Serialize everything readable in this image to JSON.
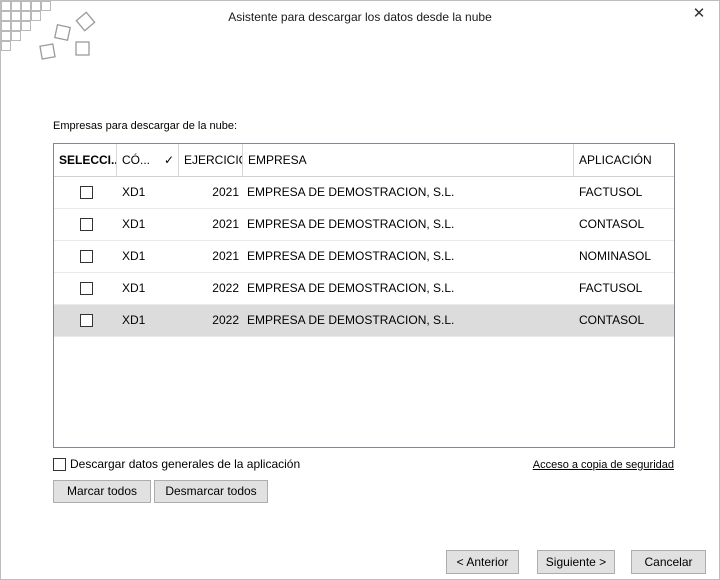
{
  "window": {
    "title": "Asistente para descargar los datos desde la nube",
    "close_glyph": "✕"
  },
  "section_label": "Empresas para descargar de la nube:",
  "grid": {
    "headers": {
      "select": "SELECCI...",
      "code": "CÓ...",
      "code_check": "✓",
      "year": "EJERCICIO",
      "company": "EMPRESA",
      "application": "APLICACIÓN"
    },
    "rows": [
      {
        "selected": false,
        "code": "XD1",
        "year": "2021",
        "company": "EMPRESA DE DEMOSTRACION, S.L.",
        "application": "FACTUSOL"
      },
      {
        "selected": false,
        "code": "XD1",
        "year": "2021",
        "company": "EMPRESA DE DEMOSTRACION, S.L.",
        "application": "CONTASOL"
      },
      {
        "selected": false,
        "code": "XD1",
        "year": "2021",
        "company": "EMPRESA DE DEMOSTRACION, S.L.",
        "application": "NOMINASOL"
      },
      {
        "selected": false,
        "code": "XD1",
        "year": "2022",
        "company": "EMPRESA DE DEMOSTRACION, S.L.",
        "application": "FACTUSOL"
      },
      {
        "selected": false,
        "code": "XD1",
        "year": "2022",
        "company": "EMPRESA DE DEMOSTRACION, S.L.",
        "application": "CONTASOL"
      }
    ]
  },
  "general_data_checkbox": {
    "label": "Descargar datos generales de la aplicación",
    "checked": false
  },
  "backup_link": "Acceso a copia de seguridad",
  "buttons": {
    "select_all": "Marcar todos",
    "deselect_all": "Desmarcar todos",
    "previous": "< Anterior",
    "next": "Siguiente >",
    "cancel": "Cancelar"
  },
  "colors": {
    "highlight_row": "#dcdcdc",
    "button_bg": "#e1e1e1",
    "logo_square": "#b5b5b5"
  },
  "icons": {
    "logo": "squares-logo-icon",
    "close": "close-icon"
  }
}
